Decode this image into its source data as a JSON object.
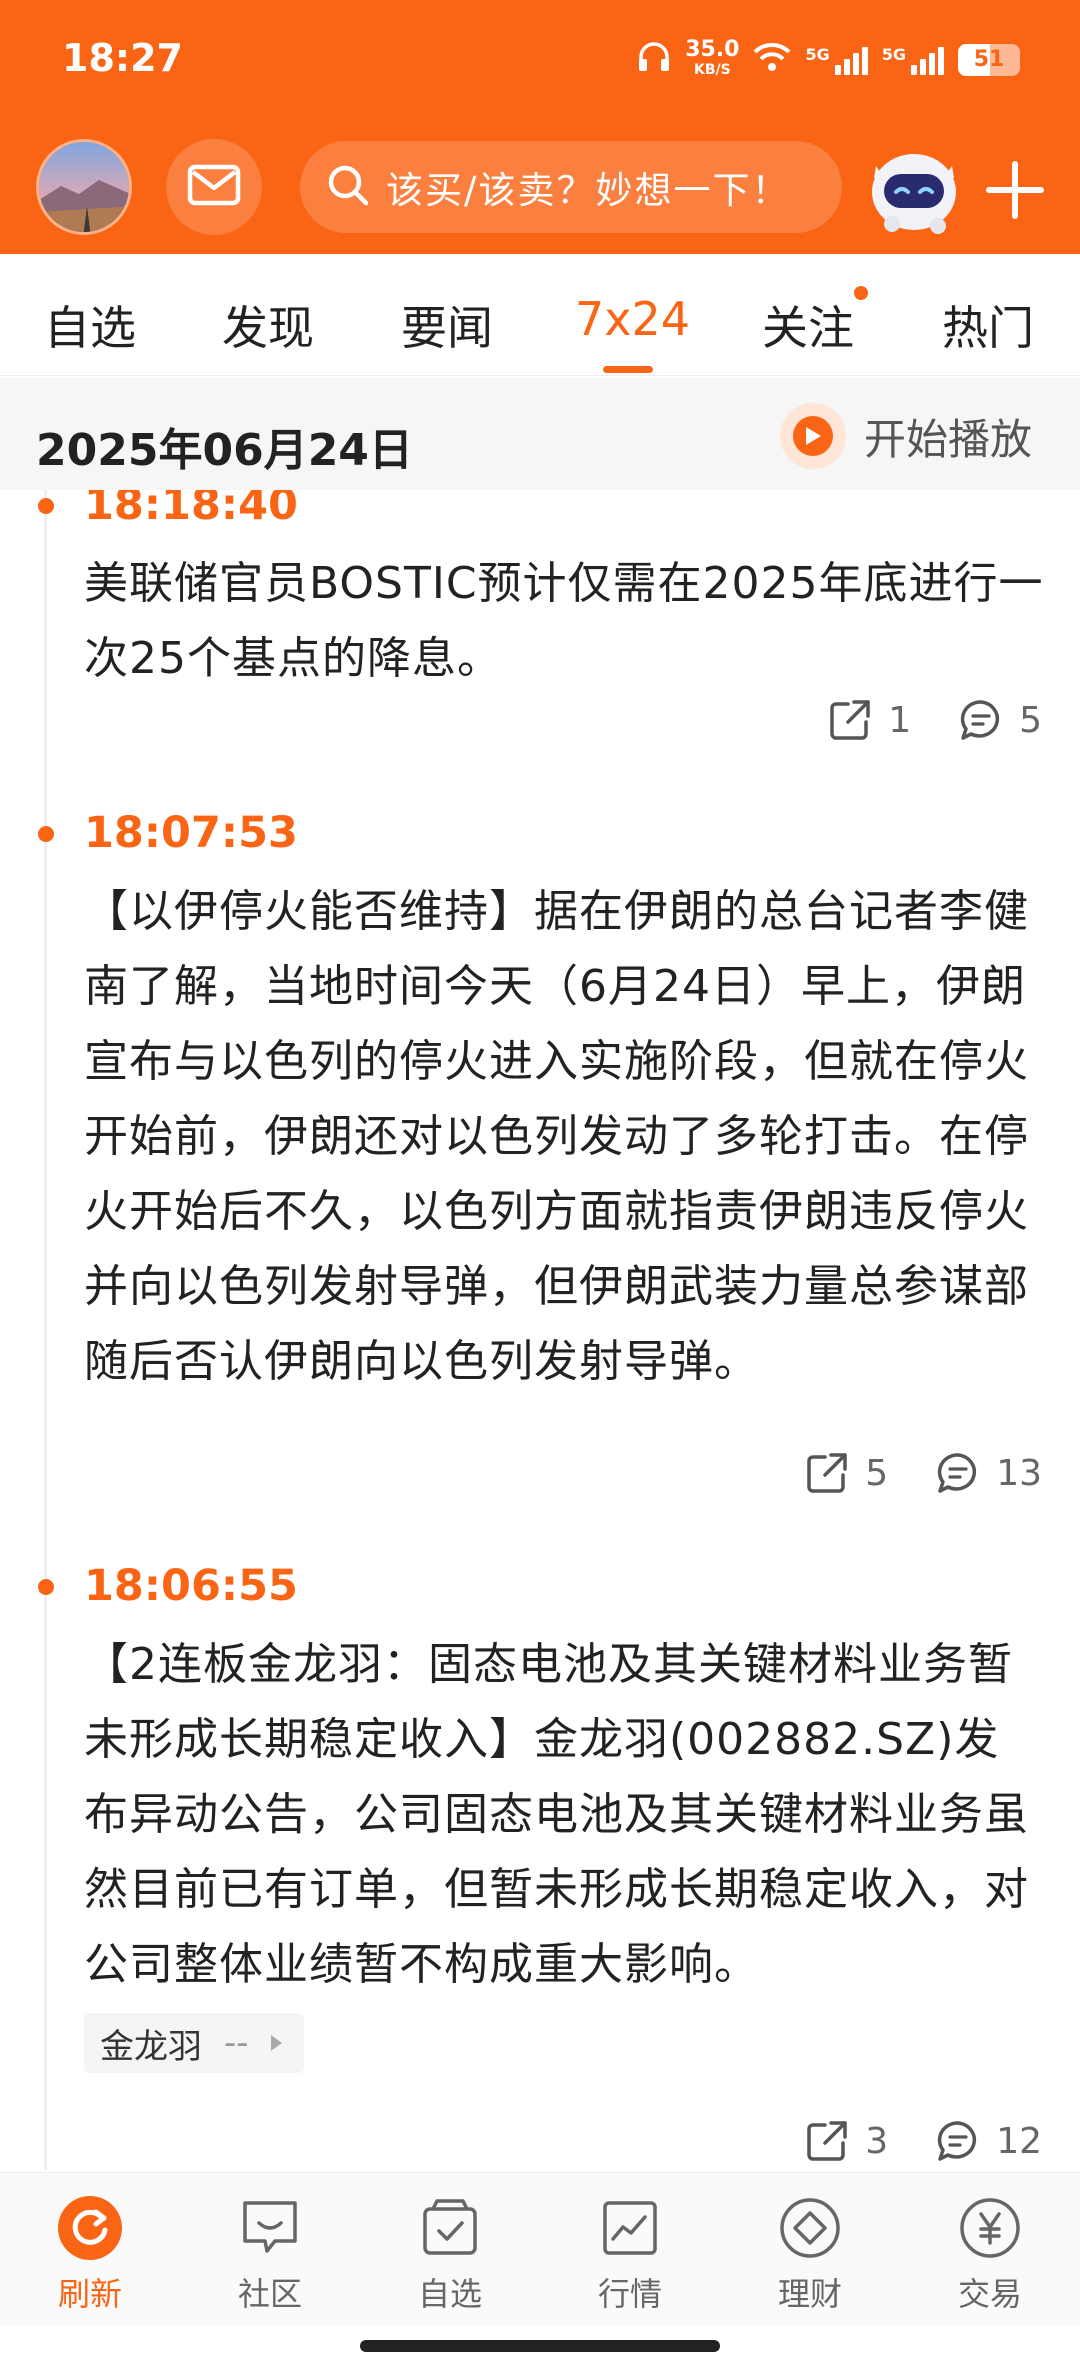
{
  "status_bar": {
    "time": "18:27",
    "net_speed": "35.0",
    "net_unit": "KB/S",
    "sig1": "5G",
    "sig2": "5G",
    "battery": "51",
    "battery_level": 0.51
  },
  "header": {
    "search_placeholder": "该买/该卖？妙想一下！",
    "icons": [
      "avatar",
      "mail-icon",
      "search-icon",
      "robot-assistant-icon",
      "plus-icon"
    ]
  },
  "tabs": [
    {
      "label": "自选",
      "active": false
    },
    {
      "label": "发现",
      "active": false
    },
    {
      "label": "要闻",
      "active": false
    },
    {
      "label": "7x24",
      "active": true
    },
    {
      "label": "关注",
      "active": false,
      "has_dot": true
    },
    {
      "label": "热门",
      "active": false
    }
  ],
  "date_bar": {
    "date": "2025年06月24日",
    "play_label": "开始播放"
  },
  "feed": [
    {
      "time": "18:18:40",
      "text": "美联储官员BOSTIC预计仅需在2025年底进行一次25个基点的降息。",
      "shares": "1",
      "comments": "5"
    },
    {
      "time": "18:07:53",
      "text": "【以伊停火能否维持】据在伊朗的总台记者李健南了解，当地时间今天（6月24日）早上，伊朗宣布与以色列的停火进入实施阶段，但就在停火开始前，伊朗还对以色列发动了多轮打击。在停火开始后不久，以色列方面就指责伊朗违反停火并向以色列发射导弹，但伊朗武装力量总参谋部随后否认伊朗向以色列发射导弹。",
      "shares": "5",
      "comments": "13"
    },
    {
      "time": "18:06:55",
      "text": "【2连板金龙羽：固态电池及其关键材料业务暂未形成长期稳定收入】金龙羽(002882.SZ)发布异动公告，公司固态电池及其关键材料业务虽然目前已有订单，但暂未形成长期稳定收入，对公司整体业绩暂不构成重大影响。",
      "stock_tag": {
        "name": "金龙羽",
        "value": "--"
      },
      "shares": "3",
      "comments": "12"
    }
  ],
  "bottom_nav": [
    {
      "label": "刷新",
      "icon": "refresh-icon",
      "active": true
    },
    {
      "label": "社区",
      "icon": "community-icon",
      "active": false
    },
    {
      "label": "自选",
      "icon": "watchlist-icon",
      "active": false
    },
    {
      "label": "行情",
      "icon": "market-chart-icon",
      "active": false
    },
    {
      "label": "理财",
      "icon": "wealth-diamond-icon",
      "active": false
    },
    {
      "label": "交易",
      "icon": "yen-trade-icon",
      "active": false
    }
  ],
  "colors": {
    "brand": "#fa6415",
    "text": "#222222",
    "muted": "#666666"
  }
}
